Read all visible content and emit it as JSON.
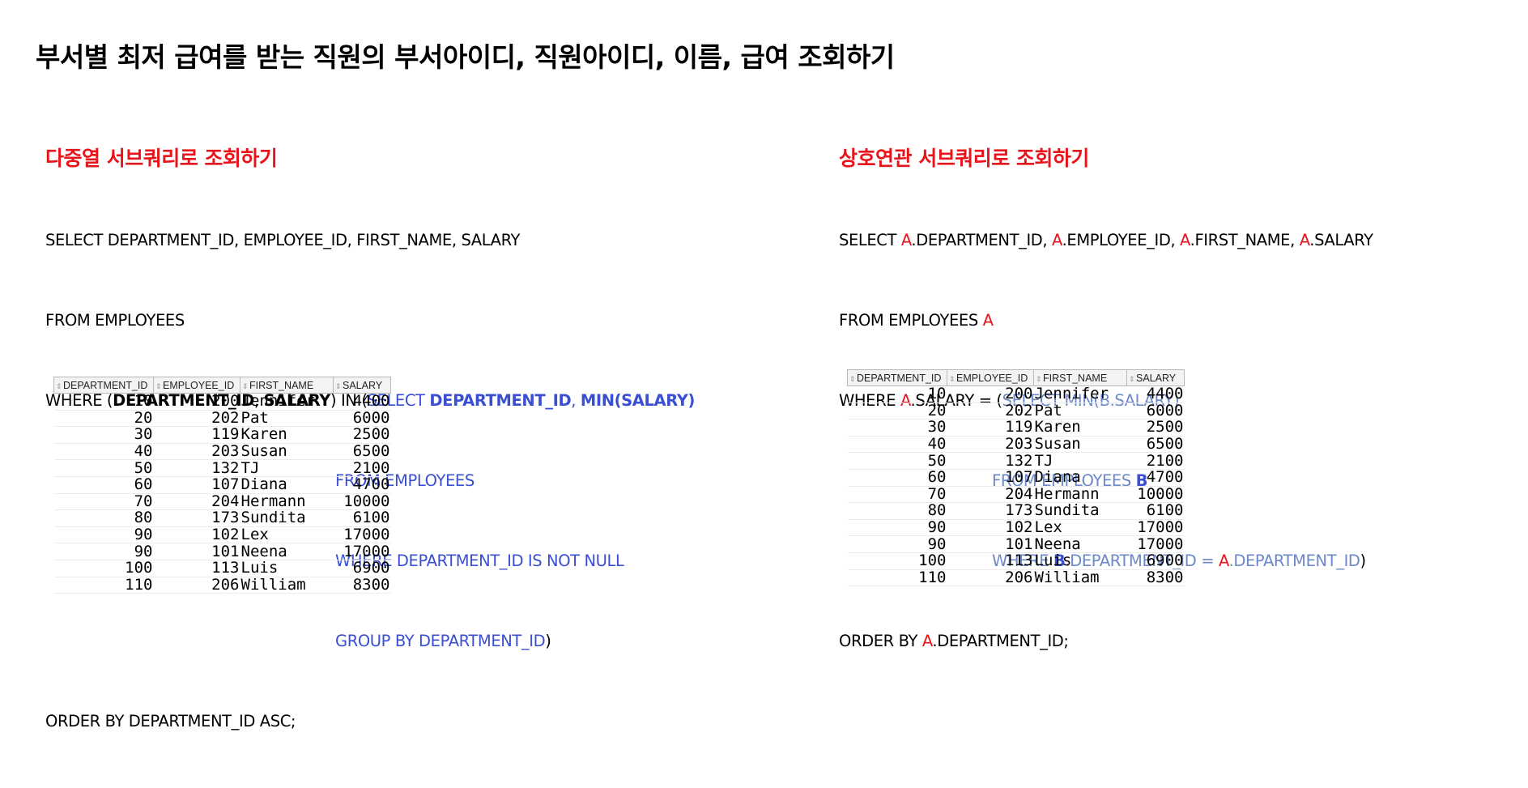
{
  "page": {
    "title": "부서별 최저 급여를 받는 직원의 부서아이디, 직원아이디, 이름, 급여 조회하기"
  },
  "left": {
    "section_title": "다중열 서브쿼리로 조회하기",
    "line1": "SELECT DEPARTMENT_ID, EMPLOYEE_ID, FIRST_NAME, SALARY",
    "line2": "FROM EMPLOYEES",
    "line3_a": "WHERE (",
    "line3_b": "DEPARTMENT_ID",
    "line3_c": ", ",
    "line3_d": "SALARY",
    "line3_e": ") IN (",
    "line3_f": "SELECT ",
    "line3_g": "DEPARTMENT_ID",
    "line3_h": ", ",
    "line3_i": "MIN(SALARY)",
    "line4": "FROM EMPLOYEES",
    "line5": "WHERE DEPARTMENT_ID IS NOT NULL",
    "line6_a": "GROUP BY DEPARTMENT_ID",
    "line6_b": ")",
    "line7": "ORDER BY DEPARTMENT_ID ASC;"
  },
  "right": {
    "section_title": "상호연관 서브쿼리로 조회하기",
    "alias_a": "A",
    "alias_b": "B",
    "l1_select": "SELECT ",
    "l1_dept": ".DEPARTMENT_ID, ",
    "l1_emp": ".EMPLOYEE_ID, ",
    "l1_name": ".FIRST_NAME, ",
    "l1_sal": ".SALARY",
    "l2": "FROM EMPLOYEES ",
    "l3_where": "WHERE ",
    "l3_sal": ".SALARY = (",
    "l3_sub": "SELECT MIN(B.SALARY)",
    "l4": "FROM EMPLOYEES ",
    "l5_where": "WHERE ",
    "l5_dept": ".DEPARTMENT_ID = ",
    "l5_dept2": ".DEPARTMENT_ID",
    "l5_close": ")",
    "l6_order": "ORDER BY ",
    "l6_dept": ".DEPARTMENT_ID;"
  },
  "table": {
    "columns": [
      "DEPARTMENT_ID",
      "EMPLOYEE_ID",
      "FIRST_NAME",
      "SALARY"
    ],
    "rows": [
      [
        "10",
        "200",
        "Jennifer",
        "4400"
      ],
      [
        "20",
        "202",
        "Pat",
        "6000"
      ],
      [
        "30",
        "119",
        "Karen",
        "2500"
      ],
      [
        "40",
        "203",
        "Susan",
        "6500"
      ],
      [
        "50",
        "132",
        "TJ",
        "2100"
      ],
      [
        "60",
        "107",
        "Diana",
        "4700"
      ],
      [
        "70",
        "204",
        "Hermann",
        "10000"
      ],
      [
        "80",
        "173",
        "Sundita",
        "6100"
      ],
      [
        "90",
        "102",
        "Lex",
        "17000"
      ],
      [
        "90",
        "101",
        "Neena",
        "17000"
      ],
      [
        "100",
        "113",
        "Luis",
        "6900"
      ],
      [
        "110",
        "206",
        "William",
        "8300"
      ]
    ]
  },
  "colors": {
    "heading_red": "#e8141c",
    "keyword_blue": "#3a4fd1",
    "subquery_light_blue": "#6d88c9"
  },
  "icons": {
    "sort_icon": "sort-arrows-icon"
  }
}
